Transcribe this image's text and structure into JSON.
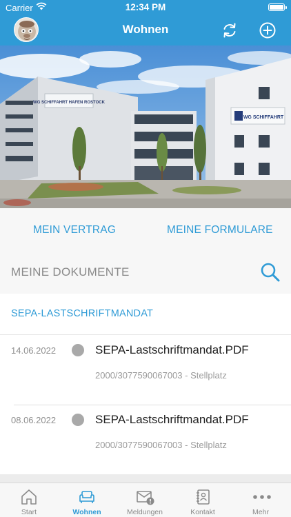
{
  "status_bar": {
    "carrier": "Carrier",
    "time": "12:34 PM"
  },
  "header": {
    "title": "Wohnen"
  },
  "hero": {
    "building_sign": "WG SCHIFFAHRT HAFEN ROSTOCK"
  },
  "links": {
    "vertrag": "MEIN VERTRAG",
    "formulare": "MEINE FORMULARE"
  },
  "documents": {
    "title": "MEINE DOKUMENTE",
    "section": "SEPA-LASTSCHRIFTMANDAT",
    "items": [
      {
        "date": "14.06.2022",
        "filename": "SEPA-Lastschriftmandat.PDF",
        "detail": "2000/3077590067003 - Stellplatz"
      },
      {
        "date": "08.06.2022",
        "filename": "SEPA-Lastschriftmandat.PDF",
        "detail": "2000/3077590067003 - Stellplatz"
      }
    ]
  },
  "tabbar": {
    "items": [
      {
        "label": "Start",
        "icon": "home-icon"
      },
      {
        "label": "Wohnen",
        "icon": "sofa-icon",
        "active": true
      },
      {
        "label": "Meldungen",
        "icon": "mail-alert-icon"
      },
      {
        "label": "Kontakt",
        "icon": "contact-book-icon"
      },
      {
        "label": "Mehr",
        "icon": "more-dots-icon"
      }
    ]
  },
  "colors": {
    "accent": "#2f9bd6",
    "header_bg": "#2f9bd6"
  }
}
